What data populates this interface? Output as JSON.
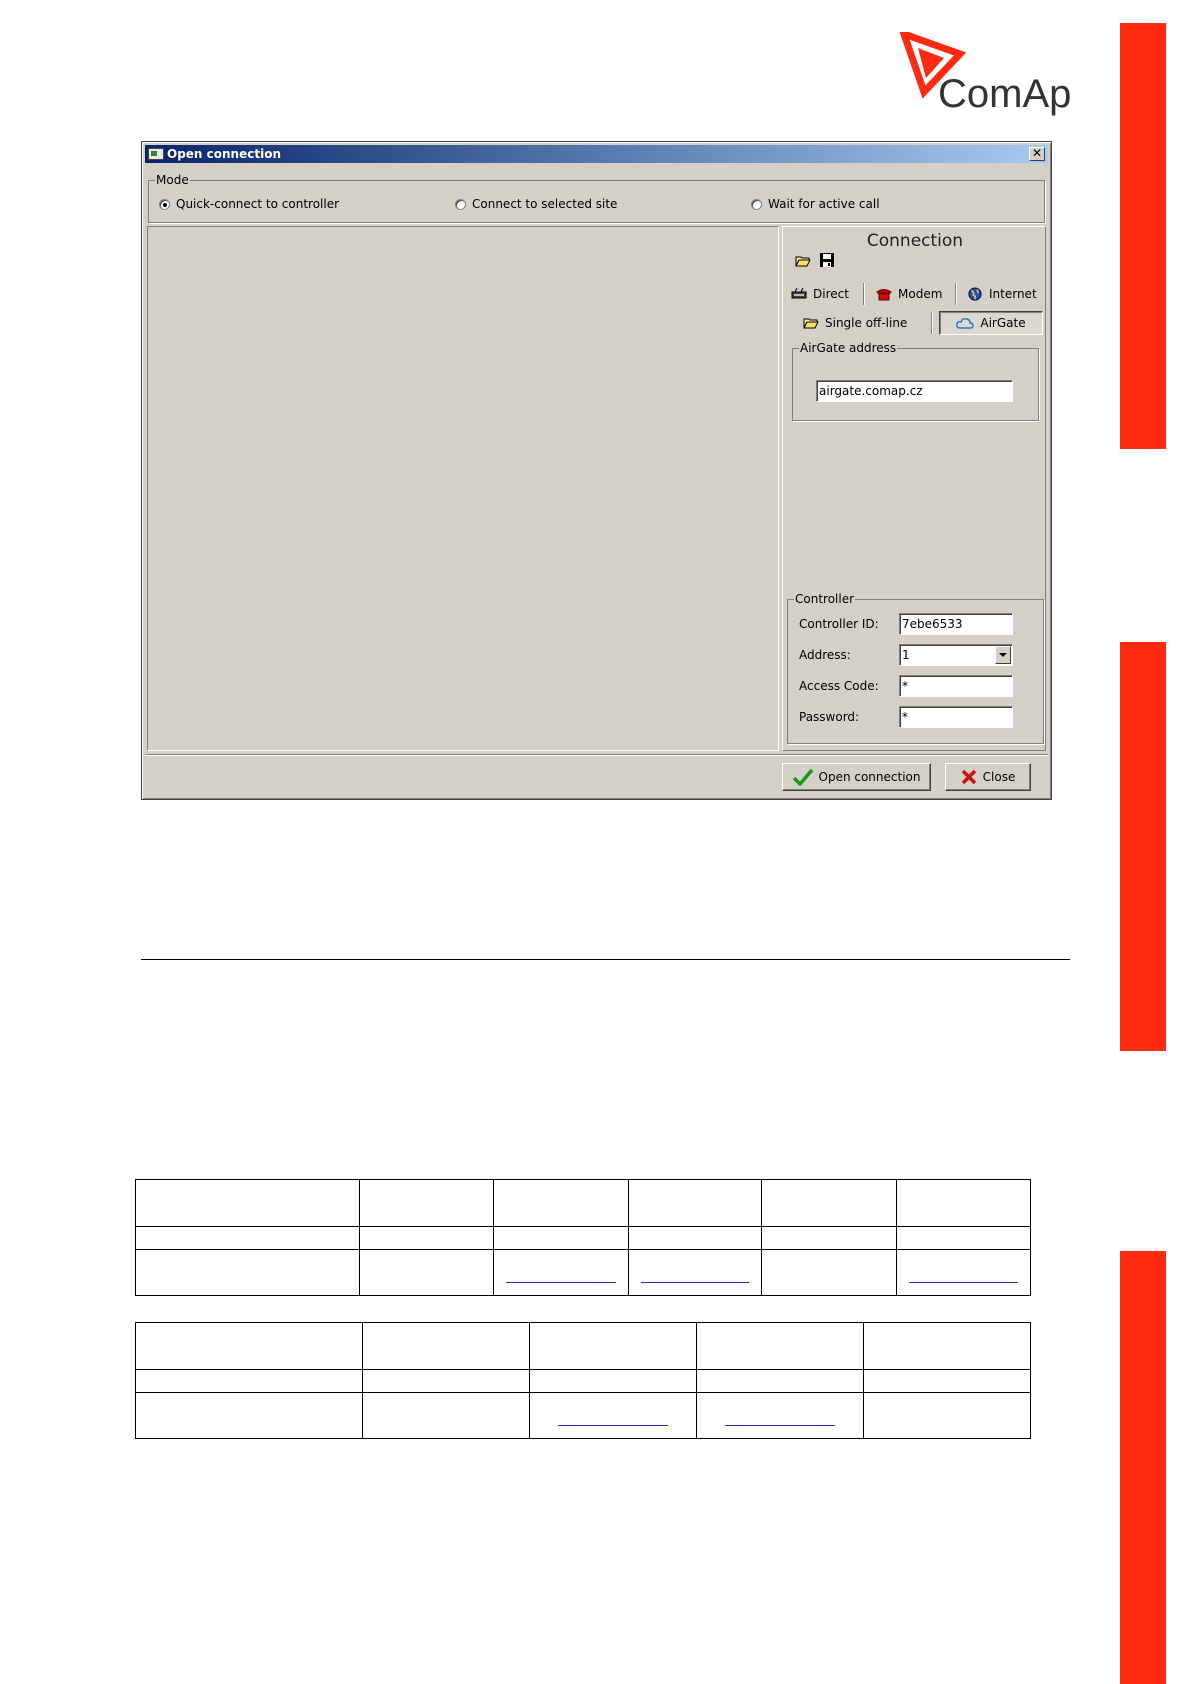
{
  "brand": {
    "logo_text": "ComAp",
    "accent_color": "#ff2a0f"
  },
  "dialog": {
    "title": "Open connection",
    "close_glyph": "✕",
    "mode": {
      "legend": "Mode",
      "options": [
        "Quick-connect to controller",
        "Connect to selected site",
        "Wait for active call"
      ],
      "selected": "Quick-connect to controller"
    },
    "connection": {
      "title": "Connection",
      "toolbar": [
        "open-folder-icon",
        "save-disk-icon"
      ],
      "tabs": [
        "Direct",
        "Modem",
        "Internet",
        "Single off-line",
        "AirGate"
      ],
      "active_tab": "AirGate",
      "airgate": {
        "legend": "AirGate address",
        "value": "airgate.comap.cz"
      },
      "controller": {
        "legend": "Controller",
        "controller_id_label": "Controller ID:",
        "controller_id_value": "7ebe6533",
        "address_label": "Address:",
        "address_value": "1",
        "access_code_label": "Access Code:",
        "access_code_value": "*",
        "password_label": "Password:",
        "password_value": "*"
      }
    },
    "buttons": {
      "open": "Open connection",
      "close": "Close"
    }
  }
}
